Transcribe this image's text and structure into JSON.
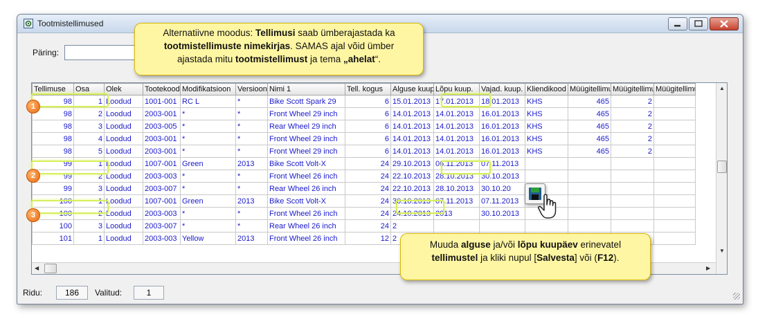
{
  "window": {
    "title": "Tootmistellimused"
  },
  "query": {
    "label": "Päring:",
    "value": ""
  },
  "columns": [
    "Tellimuse",
    "Osa",
    "Olek",
    "Tootekood",
    "Modifikatsioon",
    "Versioon",
    "Nimi 1",
    "Tell. kogus",
    "Alguse kuup.",
    "Lõpu kuup.",
    "Vajad. kuup.",
    "Kliendikood",
    "Müügitellimus",
    "Müügitellimus",
    "Müügitellimus"
  ],
  "rows": [
    [
      "98",
      "1",
      "Loodud",
      "1001-001",
      "RC L",
      "*",
      "Bike Scott Spark 29",
      "6",
      "15.01.2013",
      "17.01.2013",
      "18.01.2013",
      "KHS",
      "465",
      "2",
      ""
    ],
    [
      "98",
      "2",
      "Loodud",
      "2003-001",
      "*",
      "*",
      "Front Wheel 29 inch",
      "6",
      "14.01.2013",
      "14.01.2013",
      "16.01.2013",
      "KHS",
      "465",
      "2",
      ""
    ],
    [
      "98",
      "3",
      "Loodud",
      "2003-005",
      "*",
      "*",
      "Rear Wheel 29 inch",
      "6",
      "14.01.2013",
      "14.01.2013",
      "16.01.2013",
      "KHS",
      "465",
      "2",
      ""
    ],
    [
      "98",
      "4",
      "Loodud",
      "2003-001",
      "*",
      "*",
      "Front Wheel 29 inch",
      "6",
      "14.01.2013",
      "14.01.2013",
      "16.01.2013",
      "KHS",
      "465",
      "2",
      ""
    ],
    [
      "98",
      "5",
      "Loodud",
      "2003-001",
      "*",
      "*",
      "Front Wheel 29 inch",
      "6",
      "14.01.2013",
      "14.01.2013",
      "16.01.2013",
      "KHS",
      "465",
      "2",
      ""
    ],
    [
      "99",
      "1",
      "Loodud",
      "1007-001",
      "Green",
      "2013",
      "Bike Scott Volt-X",
      "24",
      "29.10.2013",
      "06.11.2013",
      "07.11.2013",
      "",
      "",
      "",
      ""
    ],
    [
      "99",
      "2",
      "Loodud",
      "2003-003",
      "*",
      "*",
      "Front Wheel 26 inch",
      "24",
      "22.10.2013",
      "28.10.2013",
      "30.10.2013",
      "",
      "",
      "",
      ""
    ],
    [
      "99",
      "3",
      "Loodud",
      "2003-007",
      "*",
      "*",
      "Rear Wheel 26 inch",
      "24",
      "22.10.2013",
      "28.10.2013",
      "30.10.20",
      "",
      "",
      "",
      ""
    ],
    [
      "100",
      "1",
      "Loodud",
      "1007-001",
      "Green",
      "2013",
      "Bike Scott Volt-X",
      "24",
      "30.10.2013",
      "07.11.2013",
      "07.11.2013",
      "",
      "",
      "",
      ""
    ],
    [
      "100",
      "2",
      "Loodud",
      "2003-003",
      "*",
      "*",
      "Front Wheel 26 inch",
      "24",
      "24.10.2013",
      "2013",
      "30.10.2013",
      "",
      "",
      "",
      ""
    ],
    [
      "100",
      "3",
      "Loodud",
      "2003-007",
      "*",
      "*",
      "Rear Wheel 26 inch",
      "24",
      "2",
      "",
      "",
      "",
      "",
      "",
      ""
    ],
    [
      "101",
      "1",
      "Loodud",
      "2003-003",
      "Yellow",
      "2013",
      "Front Wheel 26 inch",
      "12",
      "2",
      "",
      "",
      "",
      "",
      "",
      ""
    ]
  ],
  "status": {
    "rows_label": "Ridu:",
    "rows_value": "186",
    "selected_label": "Valitud:",
    "selected_value": "1"
  },
  "callout_top": {
    "p1": "Alternatiivne moodus: ",
    "b1": "Tellimusi",
    "p2": " saab ümberajastada ka",
    "b2": "tootmistellimuste nimekirjas",
    "p3": ". SAMAS ajal võid ümber",
    "p4": "ajastada mitu ",
    "b3": "tootmistellimust",
    "p5": " ja tema ",
    "b4": "„ahelat",
    "p6": "“."
  },
  "callout_bottom": {
    "p1": "Muuda ",
    "b1": "alguse",
    "p2": " ja/või ",
    "b2": "lõpu kuupäev",
    "p3": " erinevatel",
    "b3": "tellimustel",
    "p4": "  ja kliki nupul [",
    "b4": "Salvesta",
    "p5": "] või (",
    "b5": "F12",
    "p6": ")."
  },
  "badges": [
    "1",
    "2",
    "3"
  ],
  "icons": {
    "window": "app-icon",
    "save": "save-icon",
    "cursor": "hand-cursor-icon"
  },
  "colors": {
    "link_text": "#1a1acc",
    "changed_date": "#109010",
    "callout_bg": "#fff6a3",
    "highlight": "#d6ef5a",
    "badge": "#e86a10"
  }
}
